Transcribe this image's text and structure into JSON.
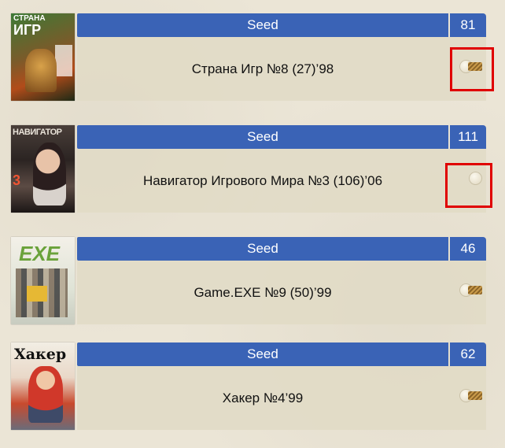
{
  "entries": [
    {
      "seed_label": "Seed",
      "count": "81",
      "title": "Страна Игр №8 (27)’98",
      "cover": {
        "icon": "magazine-cover-strana-igr",
        "accent": "#2f6b2a",
        "masthead": "СТРАНА ИГР",
        "masthead_color": "#ffffff"
      },
      "toggle_icon": "rope-toggle-icon",
      "highlighted": true,
      "toggle_has_rope": true
    },
    {
      "seed_label": "Seed",
      "count": "111",
      "title": "Навигатор Игрового Мира №3 (106)’06",
      "cover": {
        "icon": "magazine-cover-navigator",
        "accent": "#3b2e2a",
        "masthead": "НАВИГАТОР",
        "masthead_color": "#e8e2d8"
      },
      "toggle_icon": "toggle-knob-icon",
      "highlighted": true,
      "toggle_has_rope": false
    },
    {
      "seed_label": "Seed",
      "count": "46",
      "title": "Game.EXE №9 (50)’99",
      "cover": {
        "icon": "magazine-cover-game-exe",
        "accent": "#cfd8c0",
        "masthead": "EXE",
        "masthead_color": "#6aa23a"
      },
      "toggle_icon": "rope-toggle-icon",
      "highlighted": false,
      "toggle_has_rope": true
    },
    {
      "seed_label": "Seed",
      "count": "62",
      "title": "Хакер №4’99",
      "cover": {
        "icon": "magazine-cover-xakep",
        "accent": "#d24a2f",
        "masthead": "Хакер",
        "masthead_color": "#111111"
      },
      "toggle_icon": "rope-toggle-icon",
      "highlighted": false,
      "toggle_has_rope": true
    }
  ],
  "colors": {
    "bar": "#3a63b6",
    "highlight": "#e00000",
    "background": "#ebe5d6"
  }
}
